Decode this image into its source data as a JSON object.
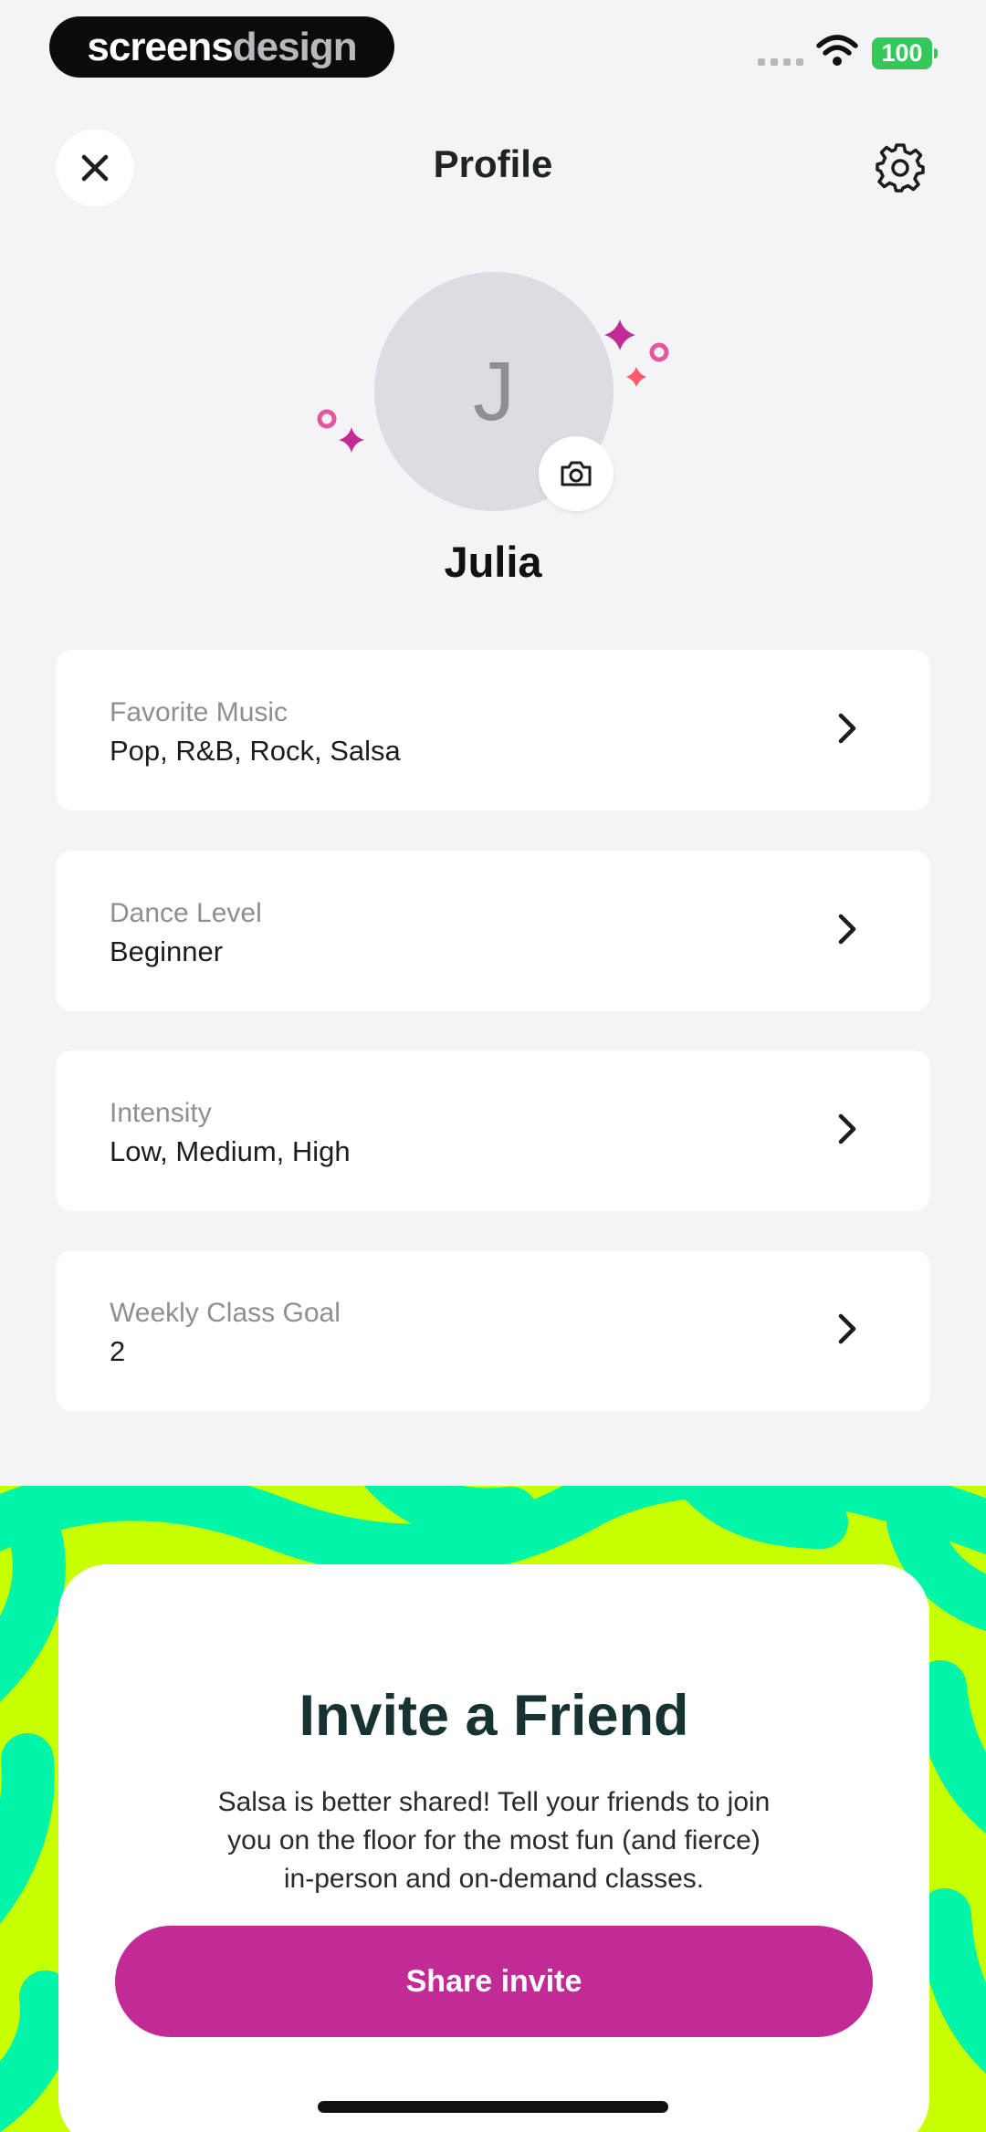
{
  "status_bar": {
    "brand_part_1": "screens",
    "brand_part_2": "design",
    "battery": "100"
  },
  "header": {
    "title": "Profile",
    "close_icon": "close-icon",
    "settings_icon": "gear-icon"
  },
  "profile": {
    "avatar_initial": "J",
    "name": "Julia",
    "camera_icon": "camera-icon"
  },
  "preferences": [
    {
      "label": "Favorite Music",
      "value": "Pop, R&B, Rock, Salsa"
    },
    {
      "label": "Dance Level",
      "value": "Beginner"
    },
    {
      "label": "Intensity",
      "value": "Low, Medium, High"
    },
    {
      "label": "Weekly Class Goal",
      "value": "2"
    }
  ],
  "invite": {
    "title": "Invite a Friend",
    "line_1": "Salsa is better shared! Tell your friends to join",
    "line_2": "you on the floor for the most fun (and fierce)",
    "line_3": "in-person and on-demand classes.",
    "button_label": "Share invite"
  },
  "colors": {
    "accent": "#c22a95",
    "background": "#f4f4f7",
    "pattern_lime": "#c8ff00",
    "pattern_teal": "#00f5a8",
    "battery": "#34c759"
  }
}
